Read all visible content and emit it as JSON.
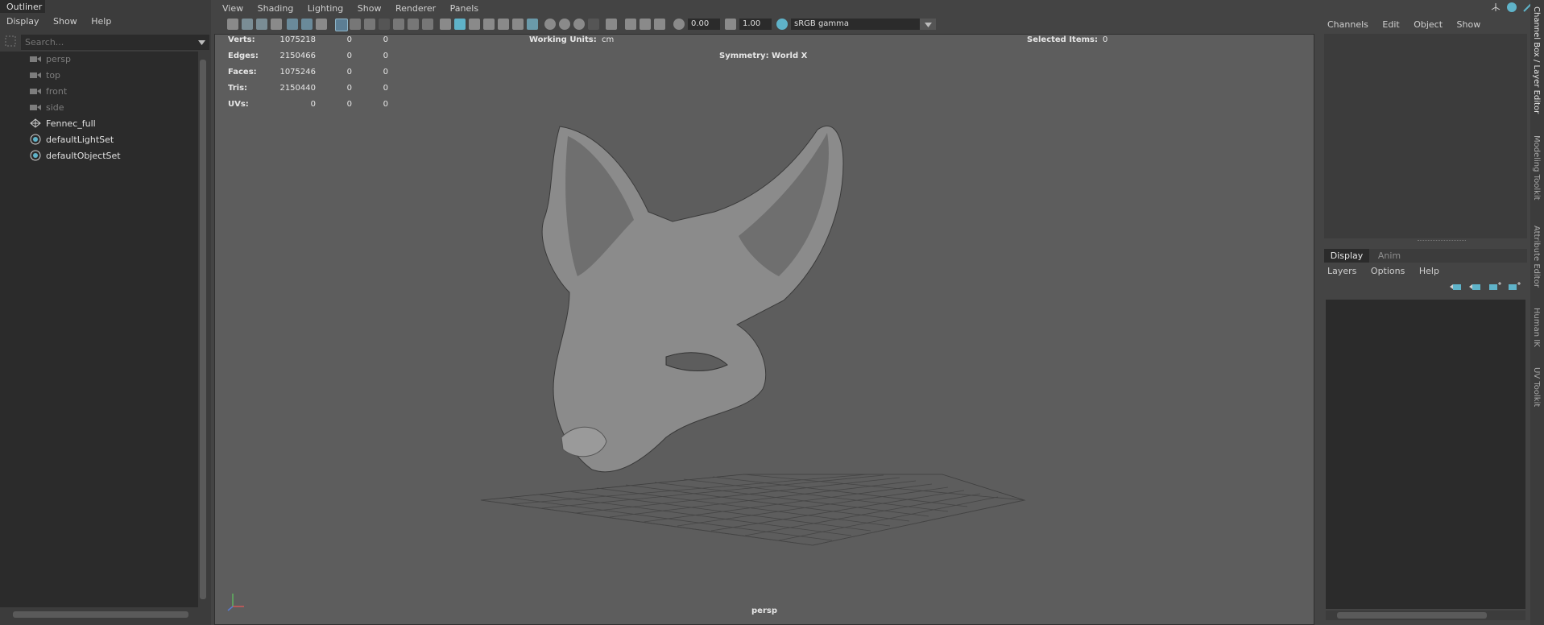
{
  "outliner": {
    "title": "Outliner",
    "menu": [
      "Display",
      "Show",
      "Help"
    ],
    "search_placeholder": "Search...",
    "items": [
      {
        "label": "persp",
        "kind": "camera"
      },
      {
        "label": "top",
        "kind": "camera"
      },
      {
        "label": "front",
        "kind": "camera"
      },
      {
        "label": "side",
        "kind": "camera"
      },
      {
        "label": "Fennec_full",
        "kind": "mesh"
      },
      {
        "label": "defaultLightSet",
        "kind": "set"
      },
      {
        "label": "defaultObjectSet",
        "kind": "set"
      }
    ]
  },
  "viewport": {
    "menu": [
      "View",
      "Shading",
      "Lighting",
      "Show",
      "Renderer",
      "Panels"
    ],
    "exposure": "0.00",
    "gamma": "1.00",
    "color_space": "sRGB gamma",
    "camera_name": "persp",
    "hud": {
      "rows": [
        {
          "label": "Verts:",
          "v1": "1075218",
          "v2": "0",
          "v3": "0"
        },
        {
          "label": "Edges:",
          "v1": "2150466",
          "v2": "0",
          "v3": "0"
        },
        {
          "label": "Faces:",
          "v1": "1075246",
          "v2": "0",
          "v3": "0"
        },
        {
          "label": "Tris:",
          "v1": "2150440",
          "v2": "0",
          "v3": "0"
        },
        {
          "label": "UVs:",
          "v1": "0",
          "v2": "0",
          "v3": "0"
        }
      ],
      "working_units_label": "Working Units:",
      "working_units_value": "cm",
      "symmetry": "Symmetry: World X",
      "selected_items_label": "Selected Items:",
      "selected_items_value": "0"
    }
  },
  "channel_box": {
    "menu": [
      "Channels",
      "Edit",
      "Object",
      "Show"
    ]
  },
  "layer_editor": {
    "tabs": [
      "Display",
      "Anim"
    ],
    "menu": [
      "Layers",
      "Options",
      "Help"
    ]
  },
  "side_tabs": [
    "Channel Box / Layer Editor",
    "Modeling Toolkit",
    "Attribute Editor",
    "Human IK",
    "UV Toolkit"
  ],
  "colors": {
    "accent": "#5fb3c9",
    "viewport_bg": "#5d5d5d",
    "panel_bg": "#444444",
    "dark_field": "#2b2b2b"
  }
}
